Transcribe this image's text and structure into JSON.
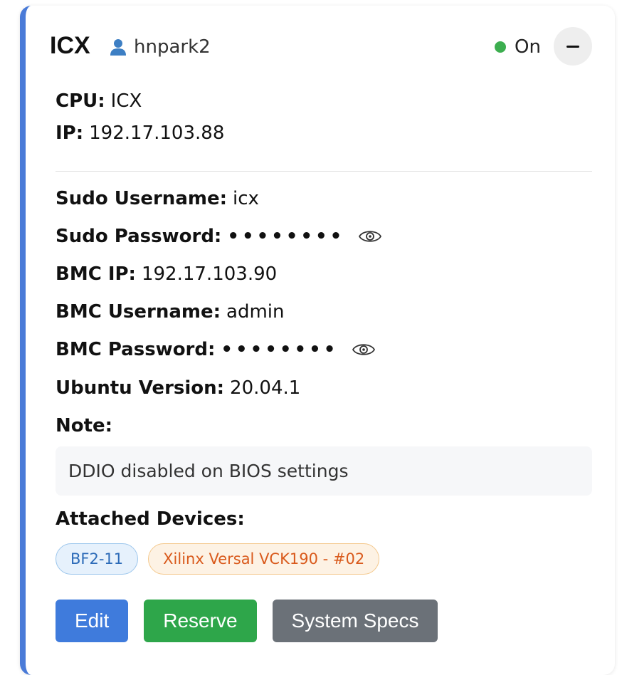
{
  "server": {
    "name": "ICX",
    "owner": "hnpark2",
    "status": "On",
    "status_color": "#3cae4f",
    "accent_color": "#4a7bd8"
  },
  "fields": {
    "cpu_label": "CPU:",
    "cpu_value": "ICX",
    "ip_label": "IP:",
    "ip_value": "192.17.103.88",
    "sudo_user_label": "Sudo Username:",
    "sudo_user_value": "icx",
    "sudo_pass_label": "Sudo Password:",
    "sudo_pass_value": "••••••••",
    "bmc_ip_label": "BMC IP:",
    "bmc_ip_value": "192.17.103.90",
    "bmc_user_label": "BMC Username:",
    "bmc_user_value": "admin",
    "bmc_pass_label": "BMC Password:",
    "bmc_pass_value": "••••••••",
    "ubuntu_label": "Ubuntu Version:",
    "ubuntu_value": "20.04.1",
    "note_label": "Note:",
    "note_value": "DDIO disabled on BIOS settings",
    "devices_label": "Attached Devices:"
  },
  "devices": [
    {
      "label": "BF2-11",
      "style": "blue"
    },
    {
      "label": "Xilinx Versal VCK190 - #02",
      "style": "orange"
    }
  ],
  "actions": {
    "edit": "Edit",
    "reserve": "Reserve",
    "specs": "System Specs"
  },
  "icons": {
    "owner": "user-icon",
    "reveal": "eye-icon",
    "collapse": "minus-icon"
  }
}
